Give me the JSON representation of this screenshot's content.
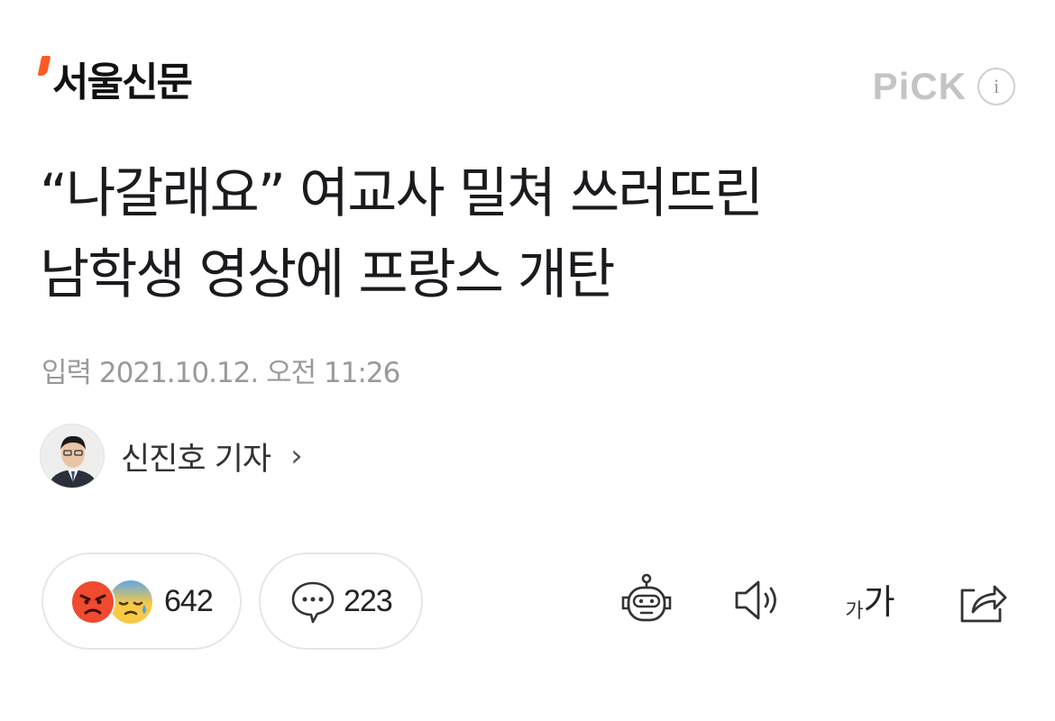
{
  "header": {
    "logo_text": "서울신문",
    "pick_label": "PiCK",
    "info_label": "i"
  },
  "article": {
    "headline_line1": "“나갈래요” 여교사 밀쳐 쓰러뜨린",
    "headline_line2": "남학생 영상에 프랑스 개탄",
    "date_label": "입력",
    "date_value": "2021.10.12. 오전 11:26",
    "author_name": "신진호 기자",
    "author_chevron": "›"
  },
  "actions": {
    "reaction_count": "642",
    "comment_count": "223",
    "font_small_glyph": "가",
    "font_large_glyph": "가"
  },
  "icons": [
    "angry-face-icon",
    "sad-sweat-face-icon",
    "comment-bubble-icon",
    "robot-icon",
    "speaker-icon",
    "font-size-icon",
    "share-icon",
    "info-icon",
    "chevron-right-icon"
  ],
  "colors": {
    "logo_accent": "#ff5a1f",
    "pick_gray": "#c4c4c4",
    "date_gray": "#9a9a9a"
  }
}
